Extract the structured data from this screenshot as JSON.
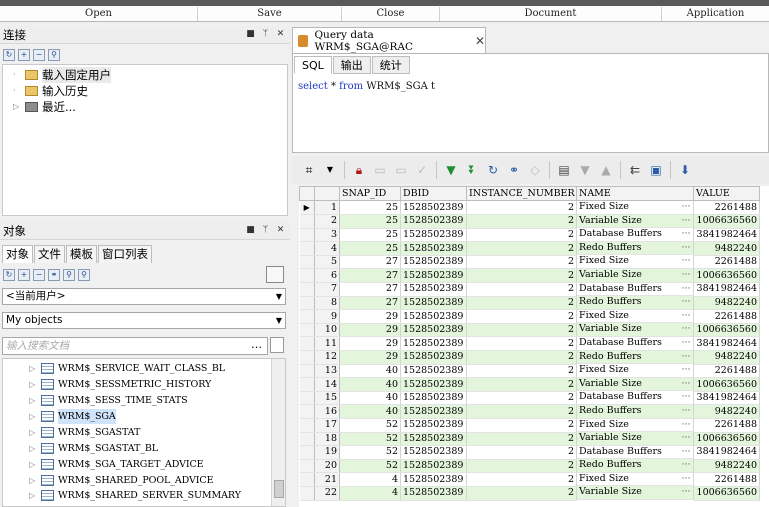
{
  "menu": [
    "Open",
    "Save",
    "Close",
    "Document",
    "Application"
  ],
  "connections": {
    "title": "连接",
    "items": [
      "载入固定用户",
      "输入历史",
      "最近..."
    ]
  },
  "objects": {
    "title": "对象",
    "tabs": [
      "对象",
      "文件",
      "模板",
      "窗口列表"
    ],
    "user_combo": "<当前用户>",
    "scope_combo": "My objects",
    "search_placeholder": "输入搜索文档",
    "items": [
      "WRM$_SERVICE_WAIT_CLASS_BL",
      "WRM$_SESSMETRIC_HISTORY",
      "WRM$_SESS_TIME_STATS",
      "WRM$_SGA",
      "WRM$_SGASTAT",
      "WRM$_SGASTAT_BL",
      "WRM$_SGA_TARGET_ADVICE",
      "WRM$_SHARED_POOL_ADVICE",
      "WRM$_SHARED_SERVER_SUMMARY"
    ]
  },
  "document_tab": "Query data WRM$_SGA@RAC",
  "sql_tabs": [
    "SQL",
    "输出",
    "统计"
  ],
  "sql": {
    "kw1": "select",
    "star": " * ",
    "kw2": "from",
    "rest": " WRM$_SGA t"
  },
  "grid": {
    "columns": [
      "SNAP_ID",
      "DBID",
      "INSTANCE_NUMBER",
      "NAME",
      "VALUE"
    ],
    "rows": [
      [
        "1",
        "25",
        "1528502389",
        "2",
        "Fixed Size",
        "2261488"
      ],
      [
        "2",
        "25",
        "1528502389",
        "2",
        "Variable Size",
        "1006636560"
      ],
      [
        "3",
        "25",
        "1528502389",
        "2",
        "Database Buffers",
        "3841982464"
      ],
      [
        "4",
        "25",
        "1528502389",
        "2",
        "Redo Buffers",
        "9482240"
      ],
      [
        "5",
        "27",
        "1528502389",
        "2",
        "Fixed Size",
        "2261488"
      ],
      [
        "6",
        "27",
        "1528502389",
        "2",
        "Variable Size",
        "1006636560"
      ],
      [
        "7",
        "27",
        "1528502389",
        "2",
        "Database Buffers",
        "3841982464"
      ],
      [
        "8",
        "27",
        "1528502389",
        "2",
        "Redo Buffers",
        "9482240"
      ],
      [
        "9",
        "29",
        "1528502389",
        "2",
        "Fixed Size",
        "2261488"
      ],
      [
        "10",
        "29",
        "1528502389",
        "2",
        "Variable Size",
        "1006636560"
      ],
      [
        "11",
        "29",
        "1528502389",
        "2",
        "Database Buffers",
        "3841982464"
      ],
      [
        "12",
        "29",
        "1528502389",
        "2",
        "Redo Buffers",
        "9482240"
      ],
      [
        "13",
        "40",
        "1528502389",
        "2",
        "Fixed Size",
        "2261488"
      ],
      [
        "14",
        "40",
        "1528502389",
        "2",
        "Variable Size",
        "1006636560"
      ],
      [
        "15",
        "40",
        "1528502389",
        "2",
        "Database Buffers",
        "3841982464"
      ],
      [
        "16",
        "40",
        "1528502389",
        "2",
        "Redo Buffers",
        "9482240"
      ],
      [
        "17",
        "52",
        "1528502389",
        "2",
        "Fixed Size",
        "2261488"
      ],
      [
        "18",
        "52",
        "1528502389",
        "2",
        "Variable Size",
        "1006636560"
      ],
      [
        "19",
        "52",
        "1528502389",
        "2",
        "Database Buffers",
        "3841982464"
      ],
      [
        "20",
        "52",
        "1528502389",
        "2",
        "Redo Buffers",
        "9482240"
      ],
      [
        "21",
        "4",
        "1528502389",
        "2",
        "Fixed Size",
        "2261488"
      ],
      [
        "22",
        "4",
        "1528502389",
        "2",
        "Variable Size",
        "1006636560"
      ]
    ]
  }
}
